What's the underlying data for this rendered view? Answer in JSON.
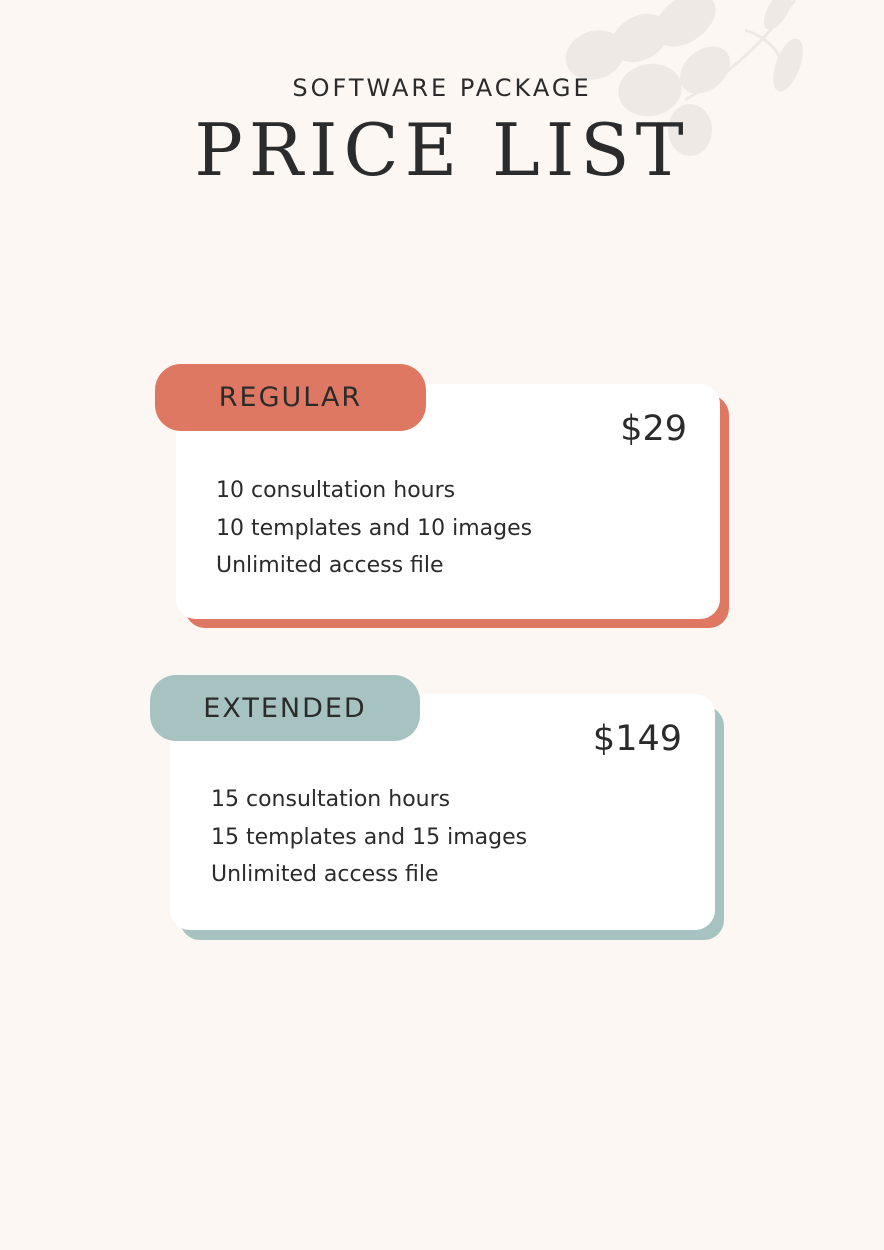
{
  "header": {
    "subtitle": "SOFTWARE PACKAGE",
    "title": "PRICE LIST"
  },
  "plans": [
    {
      "name": "REGULAR",
      "price": "$29",
      "accent_color": "#df7862",
      "features": [
        "10 consultation hours",
        "10 templates and 10 images",
        "Unlimited access file"
      ]
    },
    {
      "name": "EXTENDED",
      "price": "$149",
      "accent_color": "#a7c3c1",
      "features": [
        "15 consultation hours",
        "15 templates and 15 images",
        "Unlimited access file"
      ]
    }
  ],
  "decoration": {
    "icon": "leaves-icon"
  }
}
